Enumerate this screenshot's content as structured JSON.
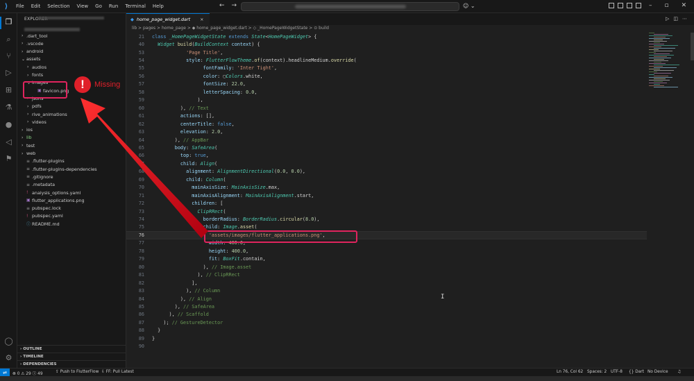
{
  "menu": [
    "File",
    "Edit",
    "Selection",
    "View",
    "Go",
    "Run",
    "Terminal",
    "Help"
  ],
  "explorer": {
    "title": "EXPLORER",
    "tree": [
      {
        "label": ".dart_tool",
        "type": "folder",
        "depth": 1,
        "open": false
      },
      {
        "label": ".vscode",
        "type": "folder",
        "depth": 1,
        "open": false
      },
      {
        "label": "android",
        "type": "folder",
        "depth": 1,
        "open": false
      },
      {
        "label": "assets",
        "type": "folder",
        "depth": 1,
        "open": true
      },
      {
        "label": "audios",
        "type": "folder",
        "depth": 2,
        "open": false
      },
      {
        "label": "fonts",
        "type": "folder",
        "depth": 2,
        "open": false
      },
      {
        "label": "images",
        "type": "folder",
        "depth": 2,
        "open": true
      },
      {
        "label": "favicon.png",
        "type": "file",
        "depth": 3
      },
      {
        "label": "jsons",
        "type": "folder",
        "depth": 2,
        "open": false
      },
      {
        "label": "pdfs",
        "type": "folder",
        "depth": 2,
        "open": false
      },
      {
        "label": "rive_animations",
        "type": "folder",
        "depth": 2,
        "open": false
      },
      {
        "label": "videos",
        "type": "folder",
        "depth": 2,
        "open": false
      },
      {
        "label": "ios",
        "type": "folder",
        "depth": 1,
        "open": false
      },
      {
        "label": "lib",
        "type": "folder",
        "depth": 1,
        "open": false,
        "green": true
      },
      {
        "label": "test",
        "type": "folder",
        "depth": 1,
        "open": false
      },
      {
        "label": "web",
        "type": "folder",
        "depth": 1,
        "open": false
      },
      {
        "label": ".flutter-plugins",
        "type": "file",
        "depth": 1
      },
      {
        "label": ".flutter-plugins-dependencies",
        "type": "file",
        "depth": 1
      },
      {
        "label": ".gitignore",
        "type": "file",
        "depth": 1
      },
      {
        "label": ".metadata",
        "type": "file",
        "depth": 1
      },
      {
        "label": "analysis_options.yaml",
        "type": "file",
        "depth": 1
      },
      {
        "label": "flutter_applications.png",
        "type": "file",
        "depth": 1
      },
      {
        "label": "pubspec.lock",
        "type": "file",
        "depth": 1
      },
      {
        "label": "pubspec.yaml",
        "type": "file",
        "depth": 1
      },
      {
        "label": "README.md",
        "type": "file",
        "depth": 1
      }
    ],
    "sections": [
      "OUTLINE",
      "TIMELINE",
      "DEPENDENCIES"
    ]
  },
  "annotation": {
    "icon": "!",
    "label": "Missing",
    "color": "#e0202a"
  },
  "editor": {
    "tab_label": "home_page_widget.dart",
    "breadcrumb": "lib > pages > home_page > ◆ home_page_widget.dart > ◇ _HomePageWidgetState > ⊙ build",
    "lines": [
      {
        "n": "21",
        "html": "<span class='kw2'>class</span> <span class='cls'>_HomePageWidgetState</span> <span class='kw2'>extends</span> <span class='cls'>State</span>&lt;<span class='cls'>HomePageWidget</span>&gt; {"
      },
      {
        "n": "40",
        "html": "  <span class='cls'>Widget</span> <span class='fn'>build</span>(<span class='cls'>BuildContext</span> <span class='prm'>context</span>) {"
      },
      {
        "n": "53",
        "html": "            <span class='str'>'Page Title'</span>,"
      },
      {
        "n": "54",
        "html": "            <span class='prm'>style</span>: <span class='cls'>FlutterFlowTheme</span>.<span class='fn'>of</span>(context).headlineMedium.<span class='fn'>override</span>("
      },
      {
        "n": "55",
        "html": "                  <span class='prm'>fontFamily</span>: <span class='str'>'Inter Tight'</span>,"
      },
      {
        "n": "56",
        "html": "                  <span class='prm'>color</span>: ▢<span class='cls'>Colors</span>.white,"
      },
      {
        "n": "57",
        "html": "                  <span class='prm'>fontSize</span>: <span class='num'>22.0</span>,"
      },
      {
        "n": "58",
        "html": "                  <span class='prm'>letterSpacing</span>: <span class='num'>0.0</span>,"
      },
      {
        "n": "59",
        "html": "                ),"
      },
      {
        "n": "60",
        "html": "          ), <span class='cm'>// Text</span>"
      },
      {
        "n": "61",
        "html": "          <span class='prm'>actions</span>: [],"
      },
      {
        "n": "62",
        "html": "          <span class='prm'>centerTitle</span>: <span class='kw2'>false</span>,"
      },
      {
        "n": "63",
        "html": "          <span class='prm'>elevation</span>: <span class='num'>2.0</span>,"
      },
      {
        "n": "64",
        "html": "        ), <span class='cm'>// AppBar</span>"
      },
      {
        "n": "65",
        "html": "        <span class='prm'>body</span>: <span class='cls'>SafeArea</span>("
      },
      {
        "n": "66",
        "html": "          <span class='prm'>top</span>: <span class='kw2'>true</span>,"
      },
      {
        "n": "67",
        "html": "          <span class='prm'>child</span>: <span class='cls'>Align</span>("
      },
      {
        "n": "68",
        "html": "            <span class='prm'>alignment</span>: <span class='cls'>AlignmentDirectional</span>(<span class='num'>0.0</span>, <span class='num'>0.0</span>),"
      },
      {
        "n": "69",
        "html": "            <span class='prm'>child</span>: <span class='cls'>Column</span>("
      },
      {
        "n": "70",
        "html": "              <span class='prm'>mainAxisSize</span>: <span class='cls'>MainAxisSize</span>.max,"
      },
      {
        "n": "71",
        "html": "              <span class='prm'>mainAxisAlignment</span>: <span class='cls'>MainAxisAlignment</span>.start,"
      },
      {
        "n": "72",
        "html": "              <span class='prm'>children</span>: ["
      },
      {
        "n": "73",
        "html": "                <span class='cls'>ClipRRect</span>("
      },
      {
        "n": "74",
        "html": "                  <span class='prm'>borderRadius</span>: <span class='cls'>BorderRadius</span>.<span class='fn'>circular</span>(<span class='num'>8.0</span>),"
      },
      {
        "n": "75",
        "html": "                  <span class='prm'>child</span>: <span class='cls'>Image</span>.<span class='fn'>asset</span>("
      },
      {
        "n": "76",
        "html": "                    <span class='str'>'assets/images/flutter_applications.png'</span>,"
      },
      {
        "n": "77",
        "html": "                    <span class='prm'>width</span>: <span class='num'>400.0</span>,"
      },
      {
        "n": "78",
        "html": "                    <span class='prm'>height</span>: <span class='num'>400.0</span>,"
      },
      {
        "n": "79",
        "html": "                    <span class='prm'>fit</span>: <span class='cls'>BoxFit</span>.contain,"
      },
      {
        "n": "80",
        "html": "                  ), <span class='cm'>// Image.asset</span>"
      },
      {
        "n": "81",
        "html": "                ), <span class='cm'>// ClipRRect</span>"
      },
      {
        "n": "82",
        "html": "              ],"
      },
      {
        "n": "83",
        "html": "            ), <span class='cm'>// Column</span>"
      },
      {
        "n": "84",
        "html": "          ), <span class='cm'>// Align</span>"
      },
      {
        "n": "85",
        "html": "        ), <span class='cm'>// SafeArea</span>"
      },
      {
        "n": "86",
        "html": "      ), <span class='cm'>// Scaffold</span>"
      },
      {
        "n": "87",
        "html": "    ); <span class='cm'>// GestureDetector</span>"
      },
      {
        "n": "88",
        "html": "  }"
      },
      {
        "n": "89",
        "html": "}"
      },
      {
        "n": "90",
        "html": ""
      }
    ]
  },
  "status": {
    "errors": "⊗ 0 ⚠ 29 ⓘ 49",
    "push": "Push to FlutterFlow",
    "ff": "FF: Pull Latest",
    "position": "Ln 76, Col 62",
    "spaces": "Spaces: 2",
    "encoding": "UTF-8",
    "language": "Dart",
    "device": "No Device"
  }
}
